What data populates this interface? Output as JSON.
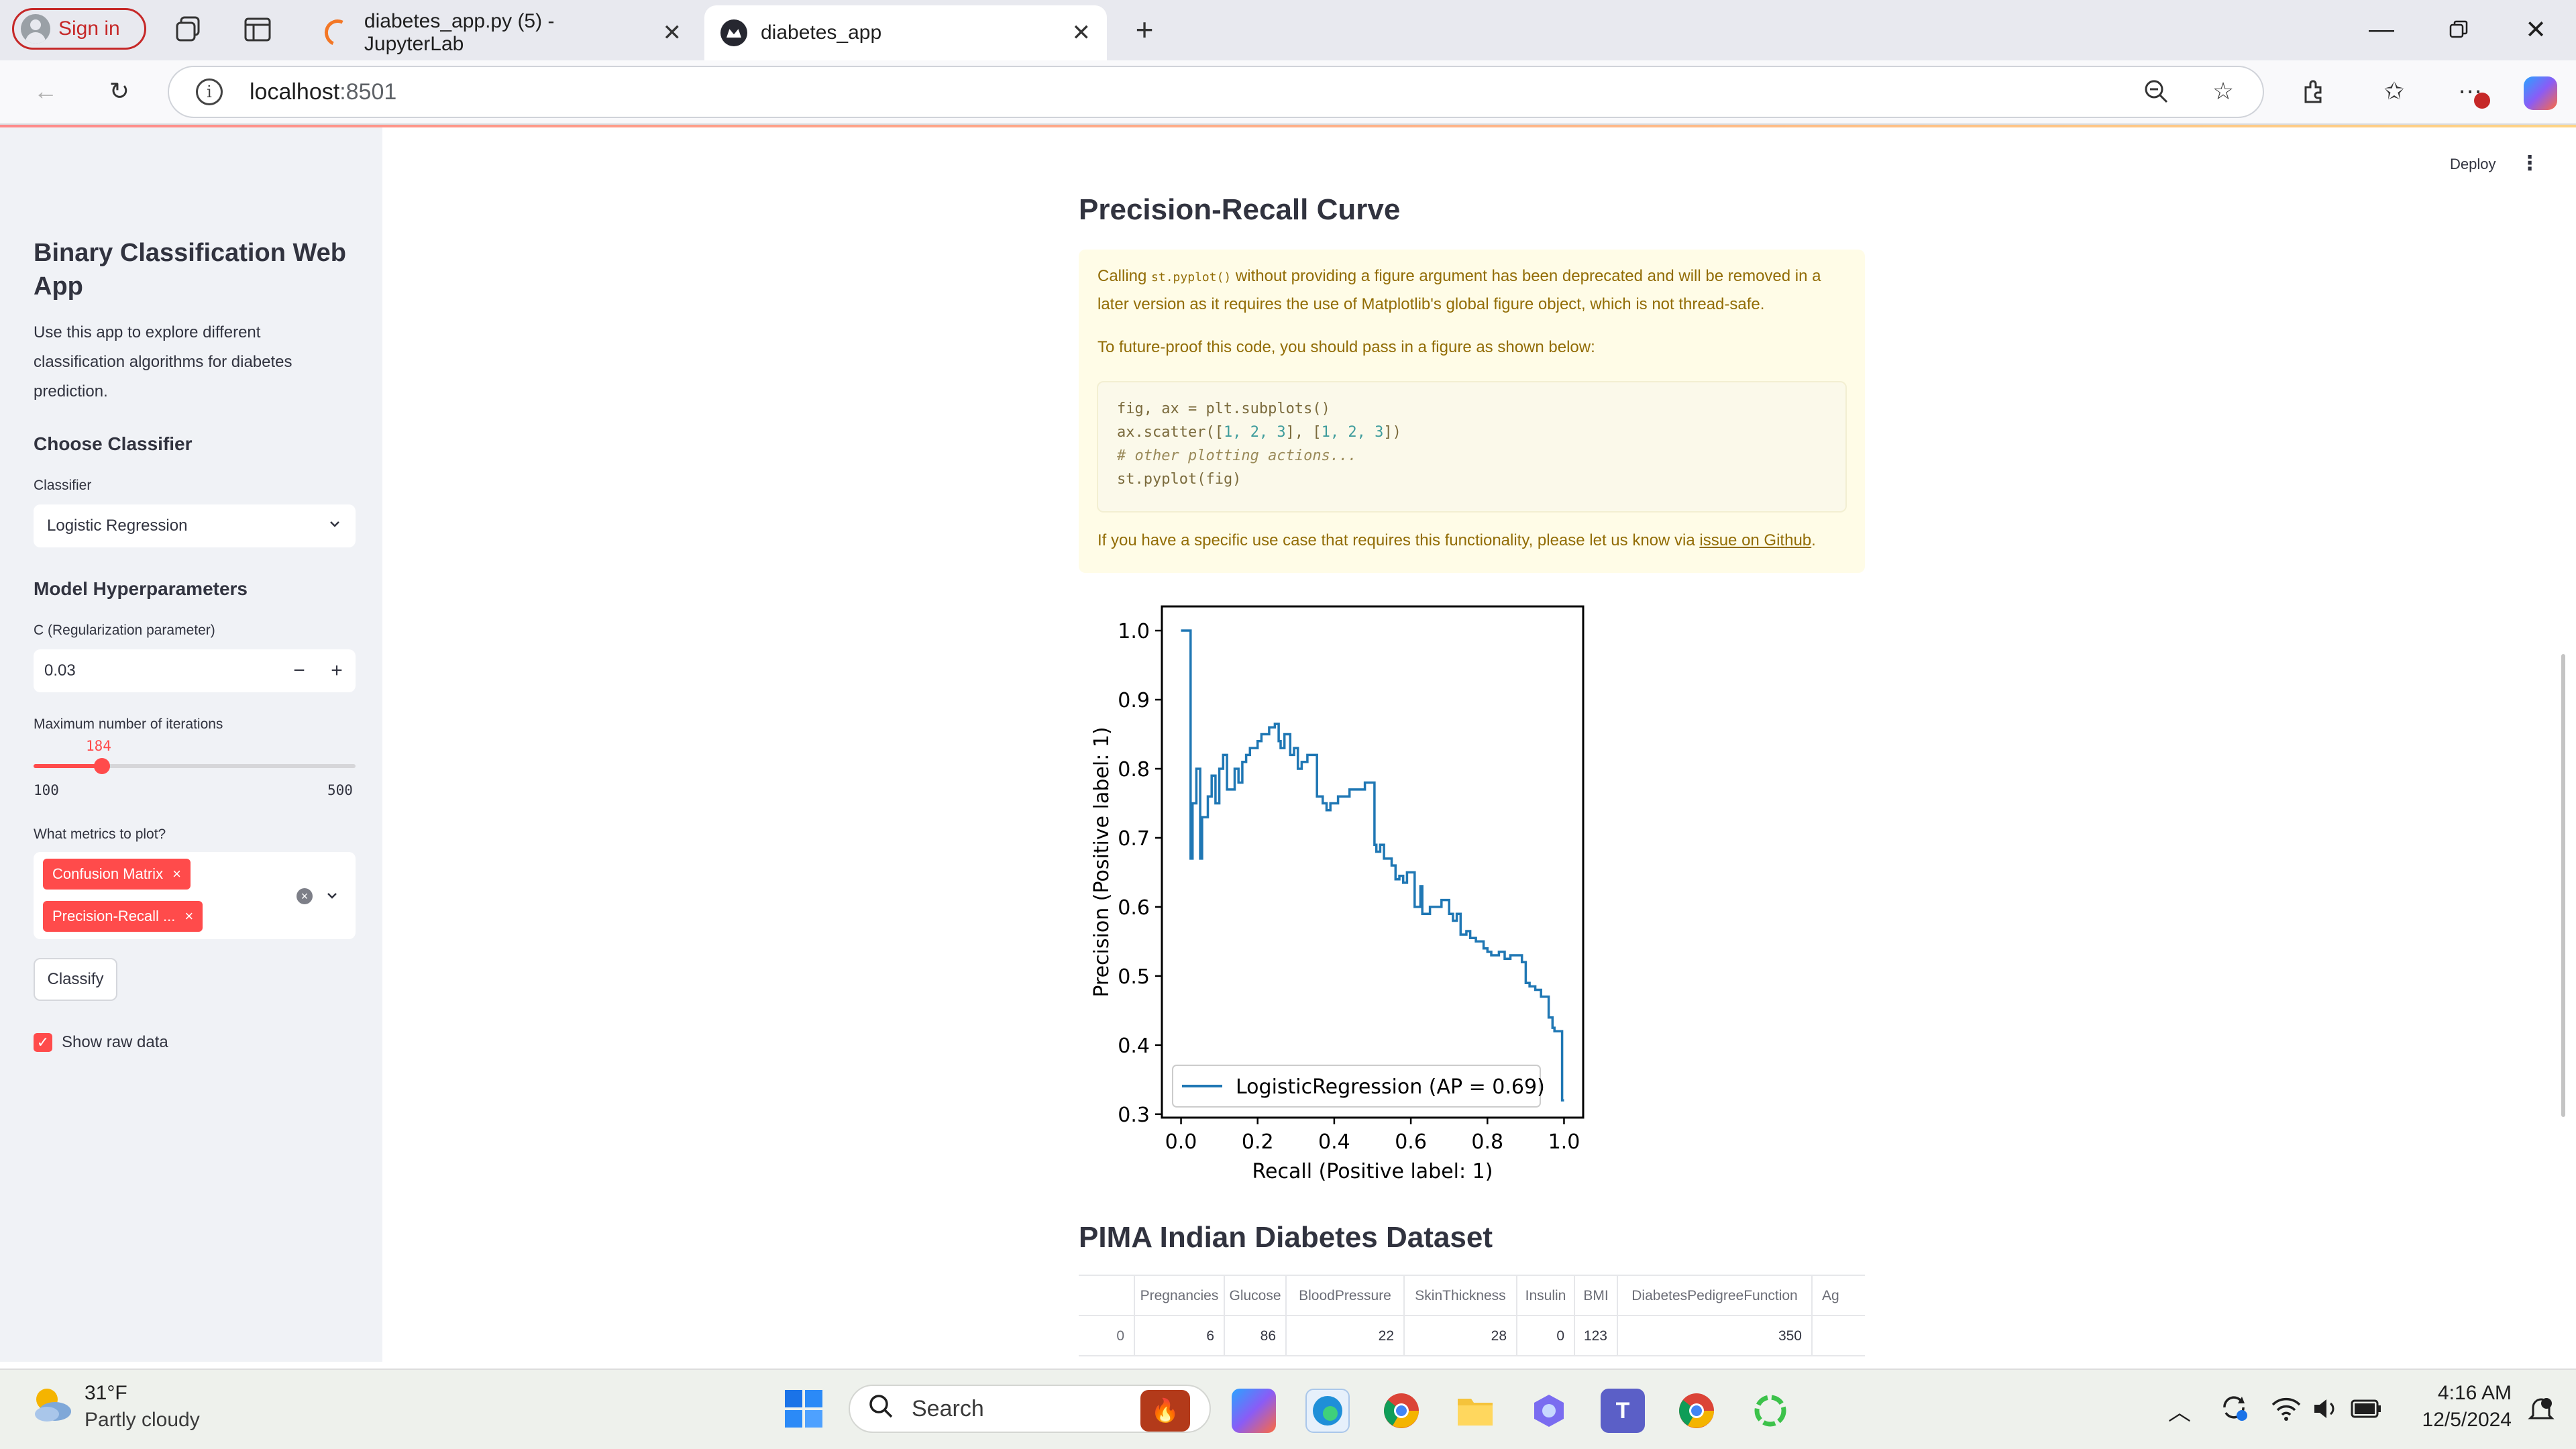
{
  "browser": {
    "signin_label": "Sign in",
    "tabs": [
      {
        "title": "diabetes_app.py (5) - JupyterLab",
        "active": false
      },
      {
        "title": "diabetes_app",
        "active": true
      }
    ],
    "url_host": "localhost",
    "url_port": ":8501"
  },
  "app": {
    "deploy_label": "Deploy",
    "sidebar": {
      "title": "Binary Classification Web App",
      "description": "Use this app to explore different classification algorithms for diabetes prediction.",
      "choose_heading": "Choose Classifier",
      "classifier_label": "Classifier",
      "classifier_value": "Logistic Regression",
      "hyper_heading": "Model Hyperparameters",
      "c_label": "C (Regularization parameter)",
      "c_value": "0.03",
      "iter_label": "Maximum number of iterations",
      "iter_value": "184",
      "iter_min": "100",
      "iter_max": "500",
      "metrics_label": "What metrics to plot?",
      "metrics_selected": [
        "Confusion Matrix",
        "Precision-Recall ..."
      ],
      "classify_label": "Classify",
      "show_raw_label": "Show raw data",
      "show_raw_checked": true
    },
    "main": {
      "pr_heading": "Precision-Recall Curve",
      "warning": {
        "p1_a": "Calling ",
        "p1_code": "st.pyplot()",
        "p1_b": " without providing a figure argument has been deprecated and will be removed in a later version as it requires the use of Matplotlib's global figure object, which is not thread-safe.",
        "p2": "To future-proof this code, you should pass in a figure as shown below:",
        "code_l1": "fig, ax = plt.subplots()",
        "code_l2_a": "ax.scatter([",
        "code_l2_n1": "1, 2, 3",
        "code_l2_b": "], [",
        "code_l2_n2": "1, 2, 3",
        "code_l2_c": "])",
        "code_l3": "# other plotting actions...",
        "code_l4": "st.pyplot(fig)",
        "p3_a": "If you have a specific use case that requires this functionality, please let us know via ",
        "p3_link": "issue on Github",
        "p3_b": "."
      },
      "dataset_heading": "PIMA Indian Diabetes Dataset",
      "table": {
        "columns": [
          "",
          "Pregnancies",
          "Glucose",
          "BloodPressure",
          "SkinThickness",
          "Insulin",
          "BMI",
          "DiabetesPedigreeFunction",
          "Ag"
        ],
        "rows": [
          [
            "0",
            "6",
            "86",
            "22",
            "28",
            "0",
            "123",
            "350",
            ""
          ]
        ]
      }
    }
  },
  "chart_data": {
    "type": "line",
    "xlabel": "Recall (Positive label: 1)",
    "ylabel": "Precision (Positive label: 1)",
    "xlim": [
      -0.05,
      1.05
    ],
    "ylim": [
      0.295,
      1.035
    ],
    "xticks": [
      "0.0",
      "0.2",
      "0.4",
      "0.6",
      "0.8",
      "1.0"
    ],
    "yticks": [
      "0.3",
      "0.4",
      "0.5",
      "0.6",
      "0.7",
      "0.8",
      "0.9",
      "1.0"
    ],
    "legend_position": "lower-left",
    "series": [
      {
        "name": "LogisticRegression (AP = 0.69)",
        "color": "#1f77b4",
        "points": [
          [
            0.0,
            1.0
          ],
          [
            0.025,
            1.0
          ],
          [
            0.025,
            0.67
          ],
          [
            0.03,
            0.67
          ],
          [
            0.03,
            0.75
          ],
          [
            0.04,
            0.75
          ],
          [
            0.04,
            0.8
          ],
          [
            0.05,
            0.8
          ],
          [
            0.05,
            0.67
          ],
          [
            0.055,
            0.67
          ],
          [
            0.055,
            0.73
          ],
          [
            0.07,
            0.73
          ],
          [
            0.07,
            0.76
          ],
          [
            0.08,
            0.76
          ],
          [
            0.08,
            0.79
          ],
          [
            0.09,
            0.79
          ],
          [
            0.09,
            0.75
          ],
          [
            0.1,
            0.75
          ],
          [
            0.1,
            0.8
          ],
          [
            0.11,
            0.8
          ],
          [
            0.11,
            0.82
          ],
          [
            0.12,
            0.82
          ],
          [
            0.12,
            0.77
          ],
          [
            0.14,
            0.77
          ],
          [
            0.14,
            0.8
          ],
          [
            0.15,
            0.8
          ],
          [
            0.15,
            0.78
          ],
          [
            0.16,
            0.78
          ],
          [
            0.16,
            0.81
          ],
          [
            0.17,
            0.81
          ],
          [
            0.17,
            0.82
          ],
          [
            0.18,
            0.82
          ],
          [
            0.18,
            0.83
          ],
          [
            0.2,
            0.83
          ],
          [
            0.2,
            0.84
          ],
          [
            0.21,
            0.84
          ],
          [
            0.21,
            0.85
          ],
          [
            0.23,
            0.85
          ],
          [
            0.23,
            0.86
          ],
          [
            0.245,
            0.86
          ],
          [
            0.245,
            0.865
          ],
          [
            0.255,
            0.865
          ],
          [
            0.255,
            0.84
          ],
          [
            0.26,
            0.84
          ],
          [
            0.26,
            0.83
          ],
          [
            0.27,
            0.83
          ],
          [
            0.27,
            0.85
          ],
          [
            0.285,
            0.85
          ],
          [
            0.285,
            0.82
          ],
          [
            0.295,
            0.82
          ],
          [
            0.295,
            0.83
          ],
          [
            0.305,
            0.83
          ],
          [
            0.305,
            0.8
          ],
          [
            0.315,
            0.8
          ],
          [
            0.315,
            0.81
          ],
          [
            0.33,
            0.81
          ],
          [
            0.33,
            0.82
          ],
          [
            0.355,
            0.82
          ],
          [
            0.355,
            0.76
          ],
          [
            0.37,
            0.76
          ],
          [
            0.37,
            0.75
          ],
          [
            0.38,
            0.75
          ],
          [
            0.38,
            0.74
          ],
          [
            0.39,
            0.74
          ],
          [
            0.39,
            0.75
          ],
          [
            0.41,
            0.75
          ],
          [
            0.41,
            0.76
          ],
          [
            0.44,
            0.76
          ],
          [
            0.44,
            0.77
          ],
          [
            0.48,
            0.77
          ],
          [
            0.48,
            0.78
          ],
          [
            0.505,
            0.78
          ],
          [
            0.505,
            0.69
          ],
          [
            0.51,
            0.69
          ],
          [
            0.51,
            0.68
          ],
          [
            0.52,
            0.68
          ],
          [
            0.52,
            0.69
          ],
          [
            0.53,
            0.69
          ],
          [
            0.53,
            0.67
          ],
          [
            0.55,
            0.67
          ],
          [
            0.55,
            0.66
          ],
          [
            0.56,
            0.66
          ],
          [
            0.56,
            0.64
          ],
          [
            0.57,
            0.64
          ],
          [
            0.57,
            0.645
          ],
          [
            0.58,
            0.645
          ],
          [
            0.58,
            0.635
          ],
          [
            0.59,
            0.635
          ],
          [
            0.59,
            0.65
          ],
          [
            0.61,
            0.65
          ],
          [
            0.61,
            0.6
          ],
          [
            0.625,
            0.6
          ],
          [
            0.625,
            0.63
          ],
          [
            0.63,
            0.63
          ],
          [
            0.63,
            0.59
          ],
          [
            0.65,
            0.59
          ],
          [
            0.65,
            0.6
          ],
          [
            0.66,
            0.6
          ],
          [
            0.66,
            0.6
          ],
          [
            0.68,
            0.6
          ],
          [
            0.68,
            0.61
          ],
          [
            0.7,
            0.61
          ],
          [
            0.7,
            0.59
          ],
          [
            0.71,
            0.59
          ],
          [
            0.71,
            0.58
          ],
          [
            0.72,
            0.58
          ],
          [
            0.72,
            0.59
          ],
          [
            0.73,
            0.59
          ],
          [
            0.73,
            0.56
          ],
          [
            0.745,
            0.56
          ],
          [
            0.745,
            0.565
          ],
          [
            0.755,
            0.565
          ],
          [
            0.755,
            0.555
          ],
          [
            0.77,
            0.555
          ],
          [
            0.77,
            0.55
          ],
          [
            0.79,
            0.55
          ],
          [
            0.79,
            0.54
          ],
          [
            0.8,
            0.54
          ],
          [
            0.8,
            0.535
          ],
          [
            0.81,
            0.535
          ],
          [
            0.81,
            0.53
          ],
          [
            0.83,
            0.53
          ],
          [
            0.83,
            0.535
          ],
          [
            0.845,
            0.535
          ],
          [
            0.845,
            0.525
          ],
          [
            0.86,
            0.525
          ],
          [
            0.86,
            0.53
          ],
          [
            0.89,
            0.53
          ],
          [
            0.89,
            0.52
          ],
          [
            0.9,
            0.52
          ],
          [
            0.9,
            0.49
          ],
          [
            0.91,
            0.49
          ],
          [
            0.91,
            0.485
          ],
          [
            0.925,
            0.485
          ],
          [
            0.925,
            0.48
          ],
          [
            0.94,
            0.48
          ],
          [
            0.94,
            0.47
          ],
          [
            0.96,
            0.47
          ],
          [
            0.96,
            0.44
          ],
          [
            0.97,
            0.44
          ],
          [
            0.97,
            0.425
          ],
          [
            0.975,
            0.425
          ],
          [
            0.975,
            0.42
          ],
          [
            0.995,
            0.42
          ],
          [
            0.995,
            0.32
          ],
          [
            1.0,
            0.32
          ]
        ]
      }
    ]
  },
  "taskbar": {
    "weather_temp": "31°F",
    "weather_desc": "Partly cloudy",
    "search_label": "Search",
    "time": "4:16 AM",
    "date": "12/5/2024"
  }
}
